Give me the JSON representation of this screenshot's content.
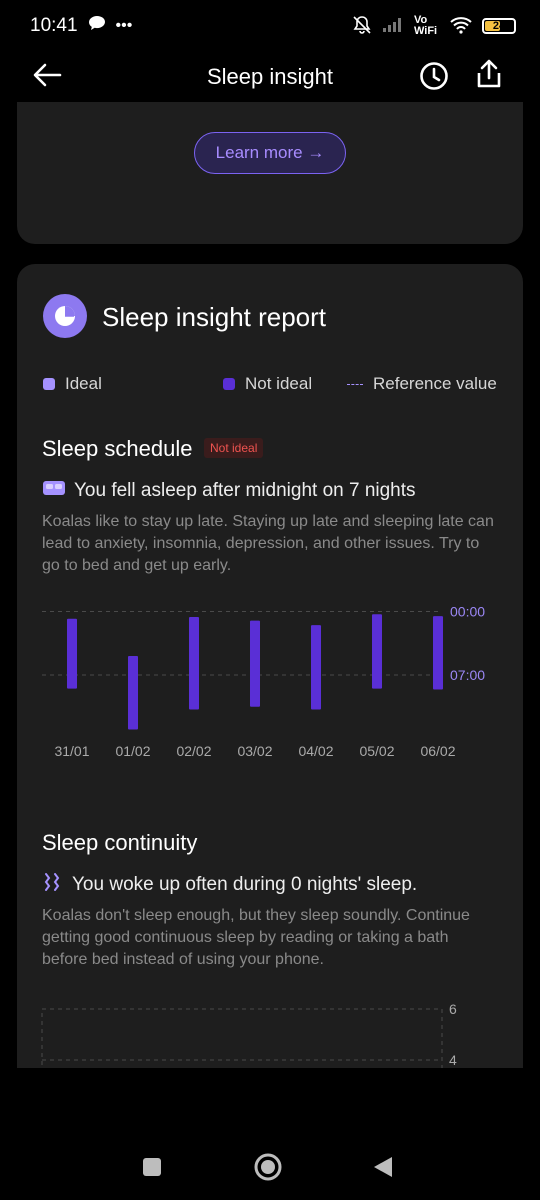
{
  "status_bar": {
    "time": "10:41",
    "network": "Vo WiFi",
    "battery": "24",
    "battery_color": "#f5c242"
  },
  "header": {
    "title": "Sleep insight",
    "back_icon": "arrow-left-icon",
    "history_icon": "clock-icon",
    "share_icon": "share-icon"
  },
  "top_card": {
    "learn_more_label": "Learn more →"
  },
  "report": {
    "title": "Sleep insight report",
    "legend": {
      "ideal": "Ideal",
      "not_ideal": "Not ideal",
      "reference": "Reference value"
    },
    "colors": {
      "ideal": "#a592ff",
      "not_ideal": "#5a2fd6",
      "accent": "#8d79f0",
      "badge_red": "#ef5350"
    }
  },
  "schedule": {
    "title": "Sleep schedule",
    "badge": "Not ideal",
    "headline": "You fell asleep after midnight on 7 nights",
    "description": "Koalas like to stay up late. Staying up late and sleeping late can lead to anxiety, insomnia, depression, and other issues. Try to go to bed and get up early."
  },
  "continuity": {
    "title": "Sleep continuity",
    "headline": "You woke up often during 0 nights' sleep.",
    "description": "Koalas don't sleep enough, but they sleep soundly. Continue getting good continuous sleep by reading or taking a bath before bed instead of using your phone."
  },
  "chart_data": [
    {
      "type": "bar",
      "categories": [
        "31/01",
        "01/02",
        "02/02",
        "03/02",
        "04/02",
        "05/02",
        "06/02"
      ],
      "y_reference_labels": [
        "00:00",
        "07:00"
      ],
      "series": [
        {
          "values_start_hours": [
            0.8,
            4.9,
            0.6,
            1.0,
            1.5,
            0.3,
            0.5
          ],
          "values_end_hours": [
            8.5,
            13.0,
            10.8,
            10.5,
            10.8,
            8.5,
            8.6
          ]
        }
      ],
      "ylim_hours": [
        -0.5,
        13.5
      ]
    },
    {
      "type": "bar",
      "categories": [],
      "tick_labels": [
        "6",
        "4"
      ],
      "series": []
    }
  ]
}
